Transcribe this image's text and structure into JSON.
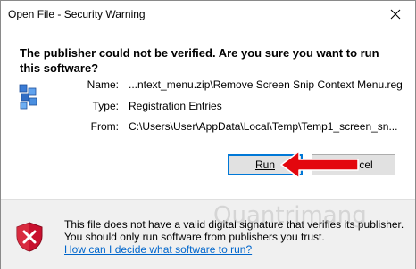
{
  "window": {
    "title": "Open File - Security Warning"
  },
  "headline": "The publisher could not be verified.  Are you sure you want to run this software?",
  "details": [
    {
      "label": "Name:",
      "value": "...ntext_menu.zip\\Remove Screen Snip Context Menu.reg"
    },
    {
      "label": "Type:",
      "value": "Registration Entries"
    },
    {
      "label": "From:",
      "value": "C:\\Users\\User\\AppData\\Local\\Temp\\Temp1_screen_sn..."
    }
  ],
  "buttons": {
    "run_label": "Run",
    "cancel_label": "Cancel",
    "cancel_visible": "cel"
  },
  "footer": {
    "message": "This file does not have a valid digital signature that verifies its publisher.  You should only run software from publishers you trust.",
    "link": "How can I decide what software to run?"
  },
  "watermark": "Quantrimang",
  "colors": {
    "accent": "#0078d7",
    "arrow": "#e3070e",
    "link": "#0066cc",
    "footer_bg": "#f0f0f0"
  },
  "icons": {
    "close": "close-icon",
    "file": "registry-file-icon",
    "warning": "warning-shield-icon",
    "arrow": "red-arrow-icon"
  }
}
